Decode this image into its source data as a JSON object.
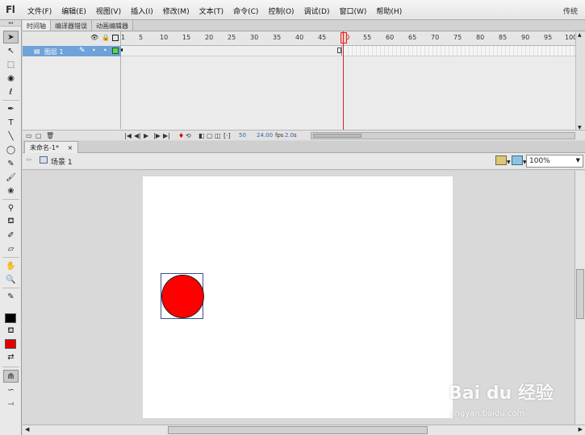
{
  "app": {
    "logo": "Fl",
    "workspace": "传统"
  },
  "menu": [
    "文件(F)",
    "编辑(E)",
    "视图(V)",
    "插入(I)",
    "修改(M)",
    "文本(T)",
    "命令(C)",
    "控制(O)",
    "调试(D)",
    "窗口(W)",
    "帮助(H)"
  ],
  "timeline": {
    "tabs": [
      "时间轴",
      "编译器错误",
      "动画编辑器"
    ],
    "active_tab": "时间轴",
    "layer": {
      "name": "图层 1"
    },
    "frame_numbers": [
      "1",
      "5",
      "10",
      "15",
      "20",
      "25",
      "30",
      "35",
      "40",
      "45",
      "50",
      "55",
      "60",
      "65",
      "70",
      "75",
      "80",
      "85",
      "90",
      "95",
      "100"
    ],
    "current_frame": "50",
    "fps": "24.00",
    "fps_unit": "fps",
    "time": "2.0",
    "time_unit": "s"
  },
  "document": {
    "tab_title": "未命名-1*",
    "tab_close": "×",
    "scene": "场景 1",
    "zoom": "100%"
  },
  "colors": {
    "stroke": "#000000",
    "fill": "#ff0000",
    "circle": "#ff0000",
    "layer_highlight": "#6fa2d8",
    "playhead": "#e02020"
  },
  "watermark": {
    "text": "Bai du 经验",
    "subtext": "jingyan.baidu.com"
  }
}
